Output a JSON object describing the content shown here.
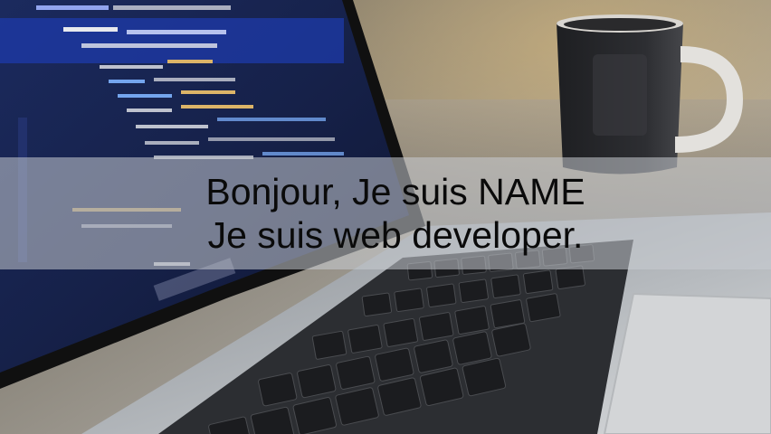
{
  "hero": {
    "line1": "Bonjour, Je suis NAME",
    "line2": "Je suis web developer."
  },
  "background": {
    "description_icon": "laptop-code-photo-icon"
  }
}
